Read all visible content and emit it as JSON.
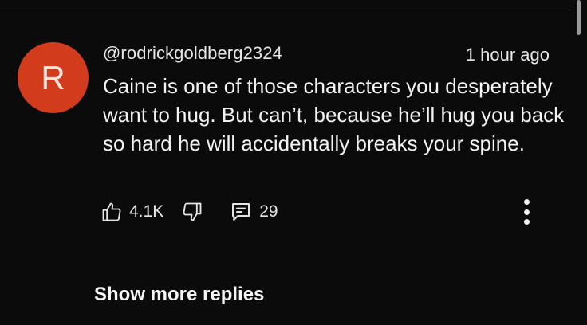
{
  "comment": {
    "avatar_letter": "R",
    "avatar_color": "#d23c1c",
    "author": "@rodrickgoldberg2324",
    "timestamp": "1 hour ago",
    "text": "Caine is one of those characters you desperately want to hug. But can’t, because he’ll hug you back so hard he will accidentally breaks your spine.",
    "like_count": "4.1K",
    "reply_count": "29",
    "icons": {
      "like": "thumbs-up-icon",
      "dislike": "thumbs-down-icon",
      "reply": "comment-icon",
      "more": "more-vertical-icon"
    }
  },
  "replies": {
    "show_more_label": "Show more replies"
  }
}
